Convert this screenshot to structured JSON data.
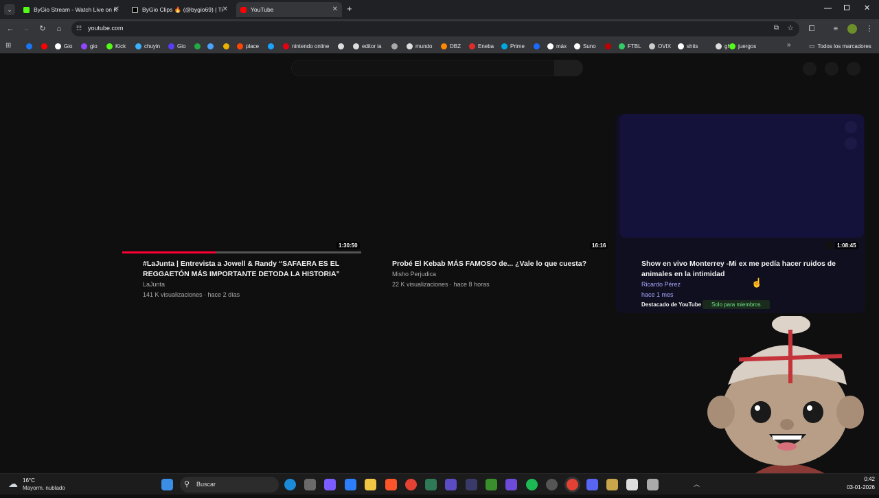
{
  "browser": {
    "tabs": [
      {
        "title": "ByGio Stream - Watch Live on K",
        "favicon_color": "#53fc18",
        "active": false
      },
      {
        "title": "ByGio Clips 🔥 (@bygio69) | Ti",
        "favicon_color": "#ffffff",
        "active": false
      },
      {
        "title": "YouTube",
        "favicon_color": "#ff0000",
        "active": true
      }
    ],
    "new_tab_label": "+",
    "url": "youtube.com",
    "bookmarks": [
      {
        "label": "",
        "color": "#1877f2"
      },
      {
        "label": "",
        "color": "#ff0000"
      },
      {
        "label": "Gio",
        "color": "#ffffff"
      },
      {
        "label": "gio",
        "color": "#9146ff"
      },
      {
        "label": "Kick",
        "color": "#53fc18"
      },
      {
        "label": "chuyin",
        "color": "#3ab0ff"
      },
      {
        "label": "Gio",
        "color": "#5b3cf5"
      },
      {
        "label": "",
        "color": "#22aa44"
      },
      {
        "label": "",
        "color": "#4aa3ff"
      },
      {
        "label": "",
        "color": "#e8b100"
      },
      {
        "label": "place",
        "color": "#ff4500"
      },
      {
        "label": "",
        "color": "#1aa3ff"
      },
      {
        "label": "nintendo online",
        "color": "#e60012"
      },
      {
        "label": "",
        "color": "#dddddd"
      },
      {
        "label": "editor ia",
        "color": "#dddddd"
      },
      {
        "label": "",
        "color": "#aaaaaa"
      },
      {
        "label": "mundo",
        "color": "#dddddd"
      },
      {
        "label": "DBZ",
        "color": "#ff8800"
      },
      {
        "label": "Eneba",
        "color": "#e02b2b"
      },
      {
        "label": "Prime",
        "color": "#00a8e1"
      },
      {
        "label": "",
        "color": "#1a6bff"
      },
      {
        "label": "máx",
        "color": "#ffffff"
      },
      {
        "label": "Suno",
        "color": "#ffffff"
      },
      {
        "label": "",
        "color": "#c00000"
      },
      {
        "label": "FTBL",
        "color": "#33cc66"
      },
      {
        "label": "OVIX",
        "color": "#cccccc"
      },
      {
        "label": "shits",
        "color": "#ffffff"
      },
      {
        "label": "gh",
        "color": "#dddddd"
      },
      {
        "label": "juergos",
        "color": "#53fc18"
      }
    ],
    "all_bookmarks_label": "Todos los marcadores"
  },
  "videos": [
    {
      "title_line1": "#LaJunta | Entrevista a Jowell & Randy “SAFAERA ES EL",
      "title_line2": "REGGAETÓN MÁS IMPORTANTE DETODA LA HISTORIA”",
      "channel": "LaJunta",
      "stats": "141 K visualizaciones · hace 2 días",
      "duration": "1:30:50",
      "watched_fraction": 0.39
    },
    {
      "title_line1": "Probé El Kebab MÁS FAMOSO de... ¿Vale lo que cuesta?",
      "title_line2": "",
      "channel": "Misho Perjudica",
      "stats": "22 K visualizaciones · hace 8 horas",
      "duration": "16:16"
    },
    {
      "title_line1": "Show en vivo Monterrey -Mi ex me pedía hacer ruidos de",
      "title_line2": "animales en la intimidad",
      "channel": "Ricardo Pérez",
      "stats": "hace 1 mes",
      "duration": "1:08:45",
      "featured_label": "Destacado de YouTube",
      "members_badge": "Solo para miembros"
    }
  ],
  "taskbar": {
    "weather_temp": "16°C",
    "weather_desc": "Mayorm. nublado",
    "search_label": "Buscar",
    "time": "0:42",
    "date": "03-01-2026"
  },
  "colors": {
    "progress": "#ff0033",
    "members_badge": "#6ee787",
    "channel_featured": "#a9a6ff"
  }
}
